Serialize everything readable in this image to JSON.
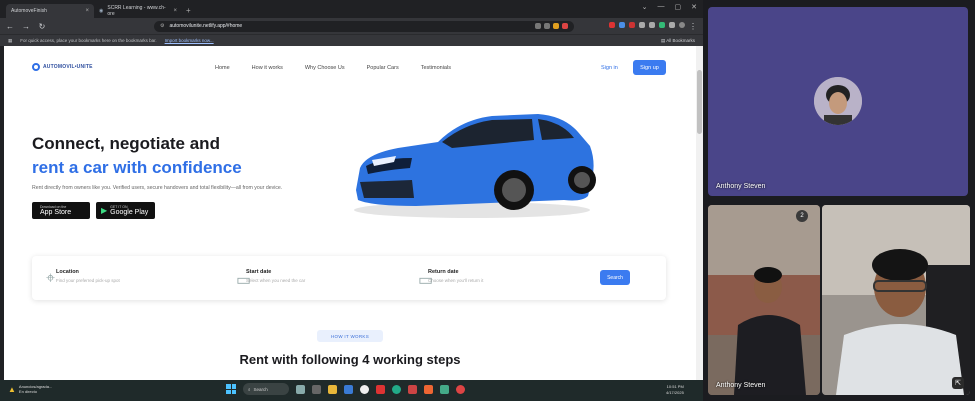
{
  "browser": {
    "tabs": [
      {
        "label": "AutomoveFinish",
        "active": true
      },
      {
        "label": "SCRR Learning - www.ch-ore",
        "active": false
      }
    ],
    "address": "automovilunite.netlify.app/#home",
    "bookmark_notice": "For quick access, place your bookmarks here on the bookmarks bar.",
    "bookmark_link": "Import bookmarks now...",
    "all_bookmarks": "All Bookmarks"
  },
  "site": {
    "logo": "AUTOMOVIL•UNITE",
    "nav": [
      "Home",
      "How it works",
      "Why Choose Us",
      "Popular Cars",
      "Testimonials"
    ],
    "signin": "Sign in",
    "signup": "Sign up",
    "hero_line1": "Connect, negotiate and",
    "hero_line2": "rent a car with confidence",
    "hero_sub": "Rent directly from owners like you. Verified users, secure handovers and total flexibility—all from your device.",
    "appstore_small": "Download on the",
    "appstore_big": "App Store",
    "playstore_small": "GET IT ON",
    "playstore_big": "Google Play",
    "search": {
      "location_label": "Location",
      "location_ph": "Find your preferred pick-up spot",
      "start_label": "Start date",
      "start_ph": "Select when you need the car",
      "return_label": "Return date",
      "return_ph": "Choose when you'll return it",
      "button": "Search"
    },
    "how_pill": "HOW IT WORKS",
    "steps_heading": "Rent with following 4 working steps",
    "car_color": "#2d73e0"
  },
  "taskbar": {
    "weather_line1": "Anuncios/agrada...",
    "weather_line2": "En directo",
    "search": "Search",
    "clock_time": "10:51 PM",
    "clock_date": "4/17/2025"
  },
  "meeting": {
    "main_name": "Anthony Steven",
    "tile_a_name": "Anthony Steven",
    "badge": "2",
    "bg_main": "#4a4589"
  }
}
